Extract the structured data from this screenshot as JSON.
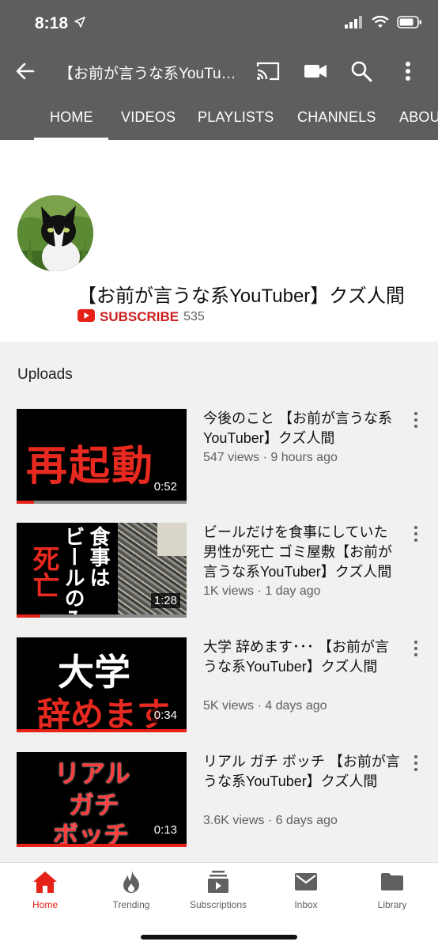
{
  "status_bar": {
    "time": "8:18"
  },
  "app_bar": {
    "title": "【お前が言うな系YouTuber】クズ人間",
    "icons": [
      "back-arrow-icon",
      "cast-icon",
      "video-camera-icon",
      "search-icon",
      "more-vert-icon"
    ]
  },
  "tabs": [
    {
      "label": "HOME",
      "selected": true
    },
    {
      "label": "VIDEOS"
    },
    {
      "label": "PLAYLISTS"
    },
    {
      "label": "CHANNELS"
    },
    {
      "label": "ABOUT"
    }
  ],
  "channel": {
    "name": "【お前が言うな系YouTuber】クズ人間",
    "subscribe_label": "SUBSCRIBE",
    "subscriber_count": "535"
  },
  "uploads": {
    "heading": "Uploads",
    "videos": [
      {
        "title": "今後のこと 【お前が言うな系YouTuber】クズ人間",
        "meta": "547 views · 9 hours ago",
        "duration": "0:52",
        "thumb_text": [
          "再起動"
        ],
        "progress": 0.1
      },
      {
        "title": "ビールだけを食事にしていた男性が死亡 ゴミ屋敷【お前が言うな系YouTuber】クズ人間",
        "meta": "1K views · 1 day ago",
        "duration": "1:28",
        "thumb_text": [
          "死亡",
          "食事は",
          "ビールのみ"
        ],
        "progress": 0.14
      },
      {
        "title": "大学 辞めます･･･ 【お前が言うな系YouTuber】クズ人間",
        "meta": "5K views · 4 days ago",
        "duration": "0:34",
        "thumb_text": [
          "大学",
          "辞めます"
        ],
        "progress": 1.0
      },
      {
        "title": "リアル ガチ ボッチ 【お前が言うな系YouTuber】クズ人間",
        "meta": "3.6K views · 6 days ago",
        "duration": "0:13",
        "thumb_text": [
          "リアル",
          "ガチ",
          "ボッチ"
        ],
        "progress": 1.0
      }
    ]
  },
  "bottom_nav": [
    {
      "label": "Home",
      "icon": "home-icon",
      "active": true
    },
    {
      "label": "Trending",
      "icon": "flame-icon"
    },
    {
      "label": "Subscriptions",
      "icon": "subscriptions-icon"
    },
    {
      "label": "Inbox",
      "icon": "mail-icon"
    },
    {
      "label": "Library",
      "icon": "folder-icon"
    }
  ],
  "colors": {
    "accent": "#e62117",
    "header": "#5e5e5e",
    "feed_bg": "#f1f1f1"
  }
}
